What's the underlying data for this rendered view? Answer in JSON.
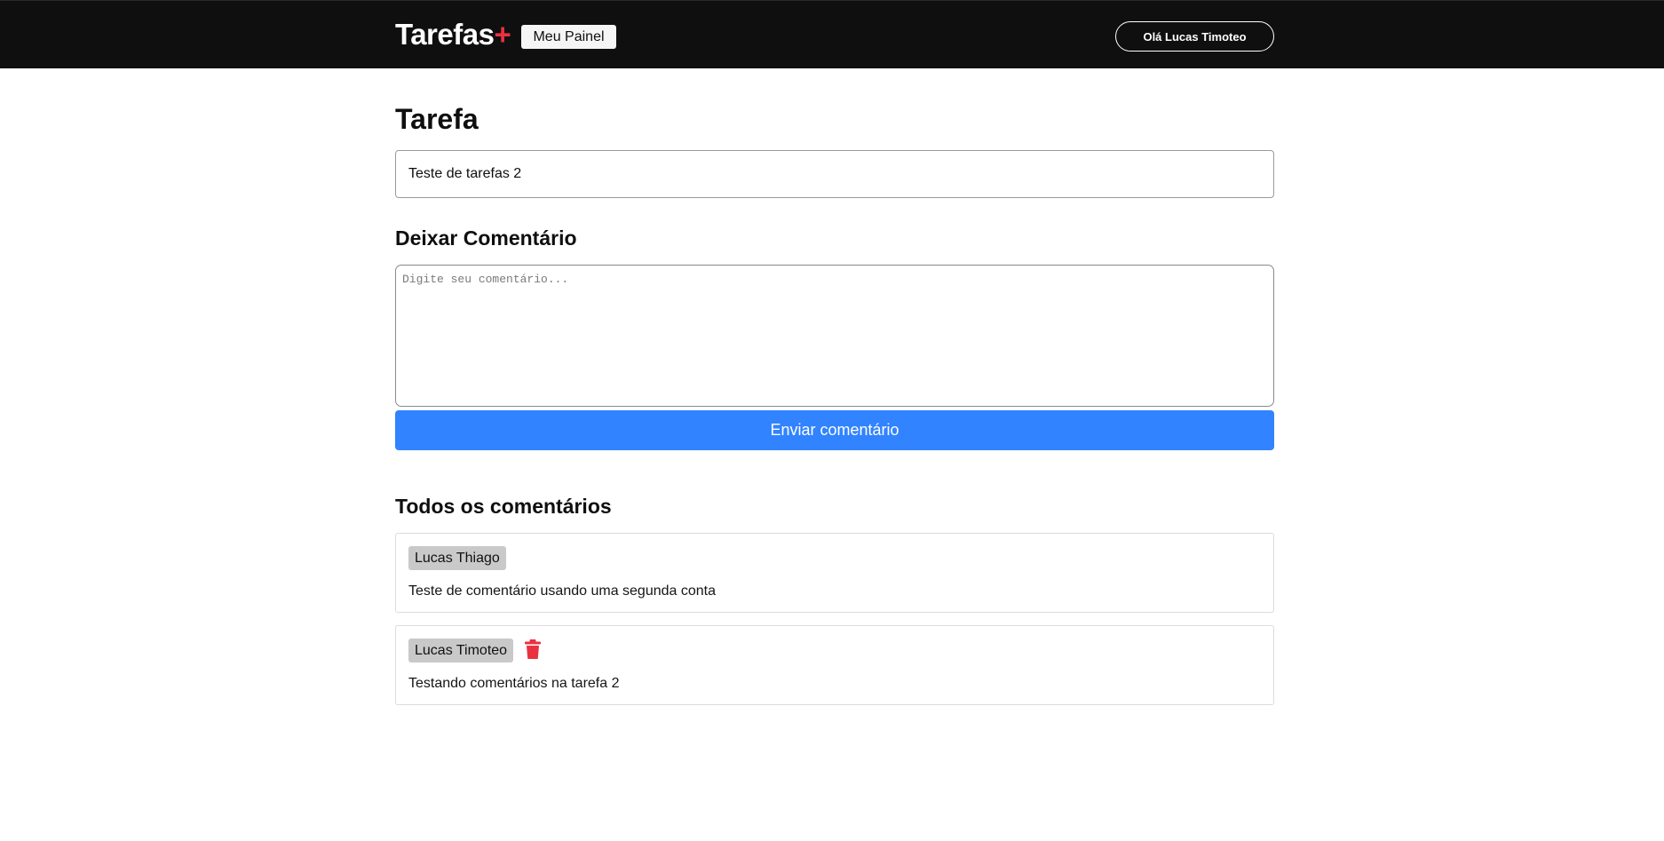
{
  "header": {
    "logo_text": "Tarefas",
    "logo_accent": "+",
    "panel_button": "Meu Painel",
    "user_button": "Olá Lucas Timoteo"
  },
  "task": {
    "heading": "Tarefa",
    "name": "Teste de tarefas 2"
  },
  "comment_form": {
    "heading": "Deixar Comentário",
    "placeholder": "Digite seu comentário...",
    "value": "",
    "submit_label": "Enviar comentário"
  },
  "comments": {
    "heading": "Todos os comentários",
    "items": [
      {
        "author": "Lucas Thiago",
        "text": "Teste de comentário usando uma segunda conta",
        "deletable": false
      },
      {
        "author": "Lucas Timoteo",
        "text": "Testando comentários na tarefa 2",
        "deletable": true,
        "delete_icon": "trash-icon"
      }
    ]
  },
  "colors": {
    "header_bg": "#0f0f0f",
    "accent_red": "#ea3140",
    "primary_blue": "#3183ff",
    "badge_gray": "#c9c9c9"
  }
}
